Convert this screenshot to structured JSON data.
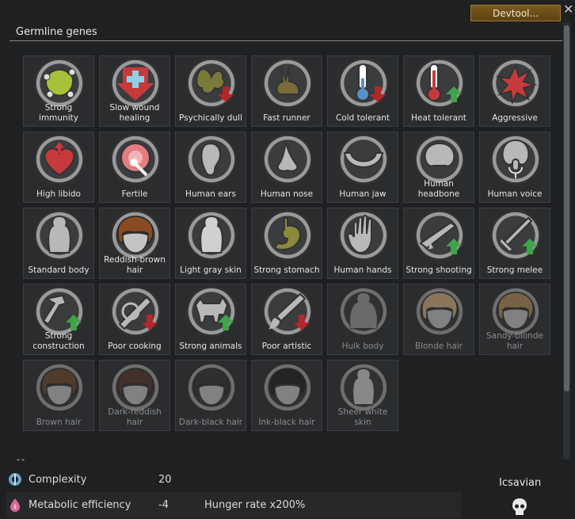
{
  "header": {
    "devtool_label": "Devtool...",
    "close_glyph": "✕",
    "section_title": "Germline genes"
  },
  "genes": [
    {
      "label": "Strong immunity",
      "icon": "immunity-icon",
      "dim": false
    },
    {
      "label": "Slow wound healing",
      "icon": "wound-healing-icon",
      "dim": false
    },
    {
      "label": "Psychically dull",
      "icon": "psychic-icon",
      "dim": false
    },
    {
      "label": "Fast runner",
      "icon": "rabbit-icon",
      "dim": false
    },
    {
      "label": "Cold tolerant",
      "icon": "thermometer-cold-icon",
      "dim": false
    },
    {
      "label": "Heat tolerant",
      "icon": "thermometer-heat-icon",
      "dim": false
    },
    {
      "label": "Aggressive",
      "icon": "aggression-icon",
      "dim": false
    },
    {
      "label": "High libido",
      "icon": "heart-icon",
      "dim": false
    },
    {
      "label": "Fertile",
      "icon": "fertility-icon",
      "dim": false
    },
    {
      "label": "Human ears",
      "icon": "ear-icon",
      "dim": false
    },
    {
      "label": "Human nose",
      "icon": "nose-icon",
      "dim": false
    },
    {
      "label": "Human jaw",
      "icon": "jaw-icon",
      "dim": false
    },
    {
      "label": "Human headbone",
      "icon": "skull-icon",
      "dim": false
    },
    {
      "label": "Human voice",
      "icon": "voice-icon",
      "dim": false
    },
    {
      "label": "Standard body",
      "icon": "body-icon",
      "dim": false
    },
    {
      "label": "Reddish-brown hair",
      "icon": "hair-icon",
      "dim": false,
      "hair": "#8a4a22"
    },
    {
      "label": "Light gray skin",
      "icon": "skin-icon",
      "dim": false
    },
    {
      "label": "Strong stomach",
      "icon": "stomach-icon",
      "dim": false
    },
    {
      "label": "Human hands",
      "icon": "hand-icon",
      "dim": false
    },
    {
      "label": "Strong shooting",
      "icon": "rifle-icon",
      "dim": false
    },
    {
      "label": "Strong melee",
      "icon": "sword-icon",
      "dim": false
    },
    {
      "label": "Strong construction",
      "icon": "hammer-icon",
      "dim": false
    },
    {
      "label": "Poor cooking",
      "icon": "cooking-icon",
      "dim": false
    },
    {
      "label": "Strong animals",
      "icon": "animal-icon",
      "dim": false
    },
    {
      "label": "Poor artistic",
      "icon": "artistic-icon",
      "dim": false
    },
    {
      "label": "Hulk body",
      "icon": "hulk-body-icon",
      "dim": true
    },
    {
      "label": "Blonde hair",
      "icon": "hair-icon",
      "dim": true,
      "hair": "#d4b07a"
    },
    {
      "label": "Sandy-blonde hair",
      "icon": "hair-icon",
      "dim": true,
      "hair": "#b08a52"
    },
    {
      "label": "Brown hair",
      "icon": "hair-icon",
      "dim": true,
      "hair": "#6e4424"
    },
    {
      "label": "Dark-reddish hair",
      "icon": "hair-icon",
      "dim": true,
      "hair": "#4e3222"
    },
    {
      "label": "Dark-black hair",
      "icon": "hair-icon",
      "dim": true,
      "hair": "#2e2e2e"
    },
    {
      "label": "Ink-black hair",
      "icon": "hair-icon",
      "dim": true,
      "hair": "#1a1a1a"
    },
    {
      "label": "Sheer white skin",
      "icon": "skin-icon",
      "dim": true
    }
  ],
  "stats": {
    "complexity": {
      "label": "Complexity",
      "value": "20",
      "icon": "complexity-icon"
    },
    "metabolic": {
      "label": "Metabolic efficiency",
      "value": "-4",
      "extra": "Hunger rate x200%",
      "icon": "metabolism-icon"
    }
  },
  "xenotype": {
    "name": "Icsavian",
    "icon": "xenotype-skull-icon"
  },
  "colors": {
    "upgrade_arrow": "#3fa34a",
    "downgrade_arrow": "#b3262b",
    "gene_cell_bg": "#2a2c2e",
    "panel_bg": "#1e2022"
  }
}
